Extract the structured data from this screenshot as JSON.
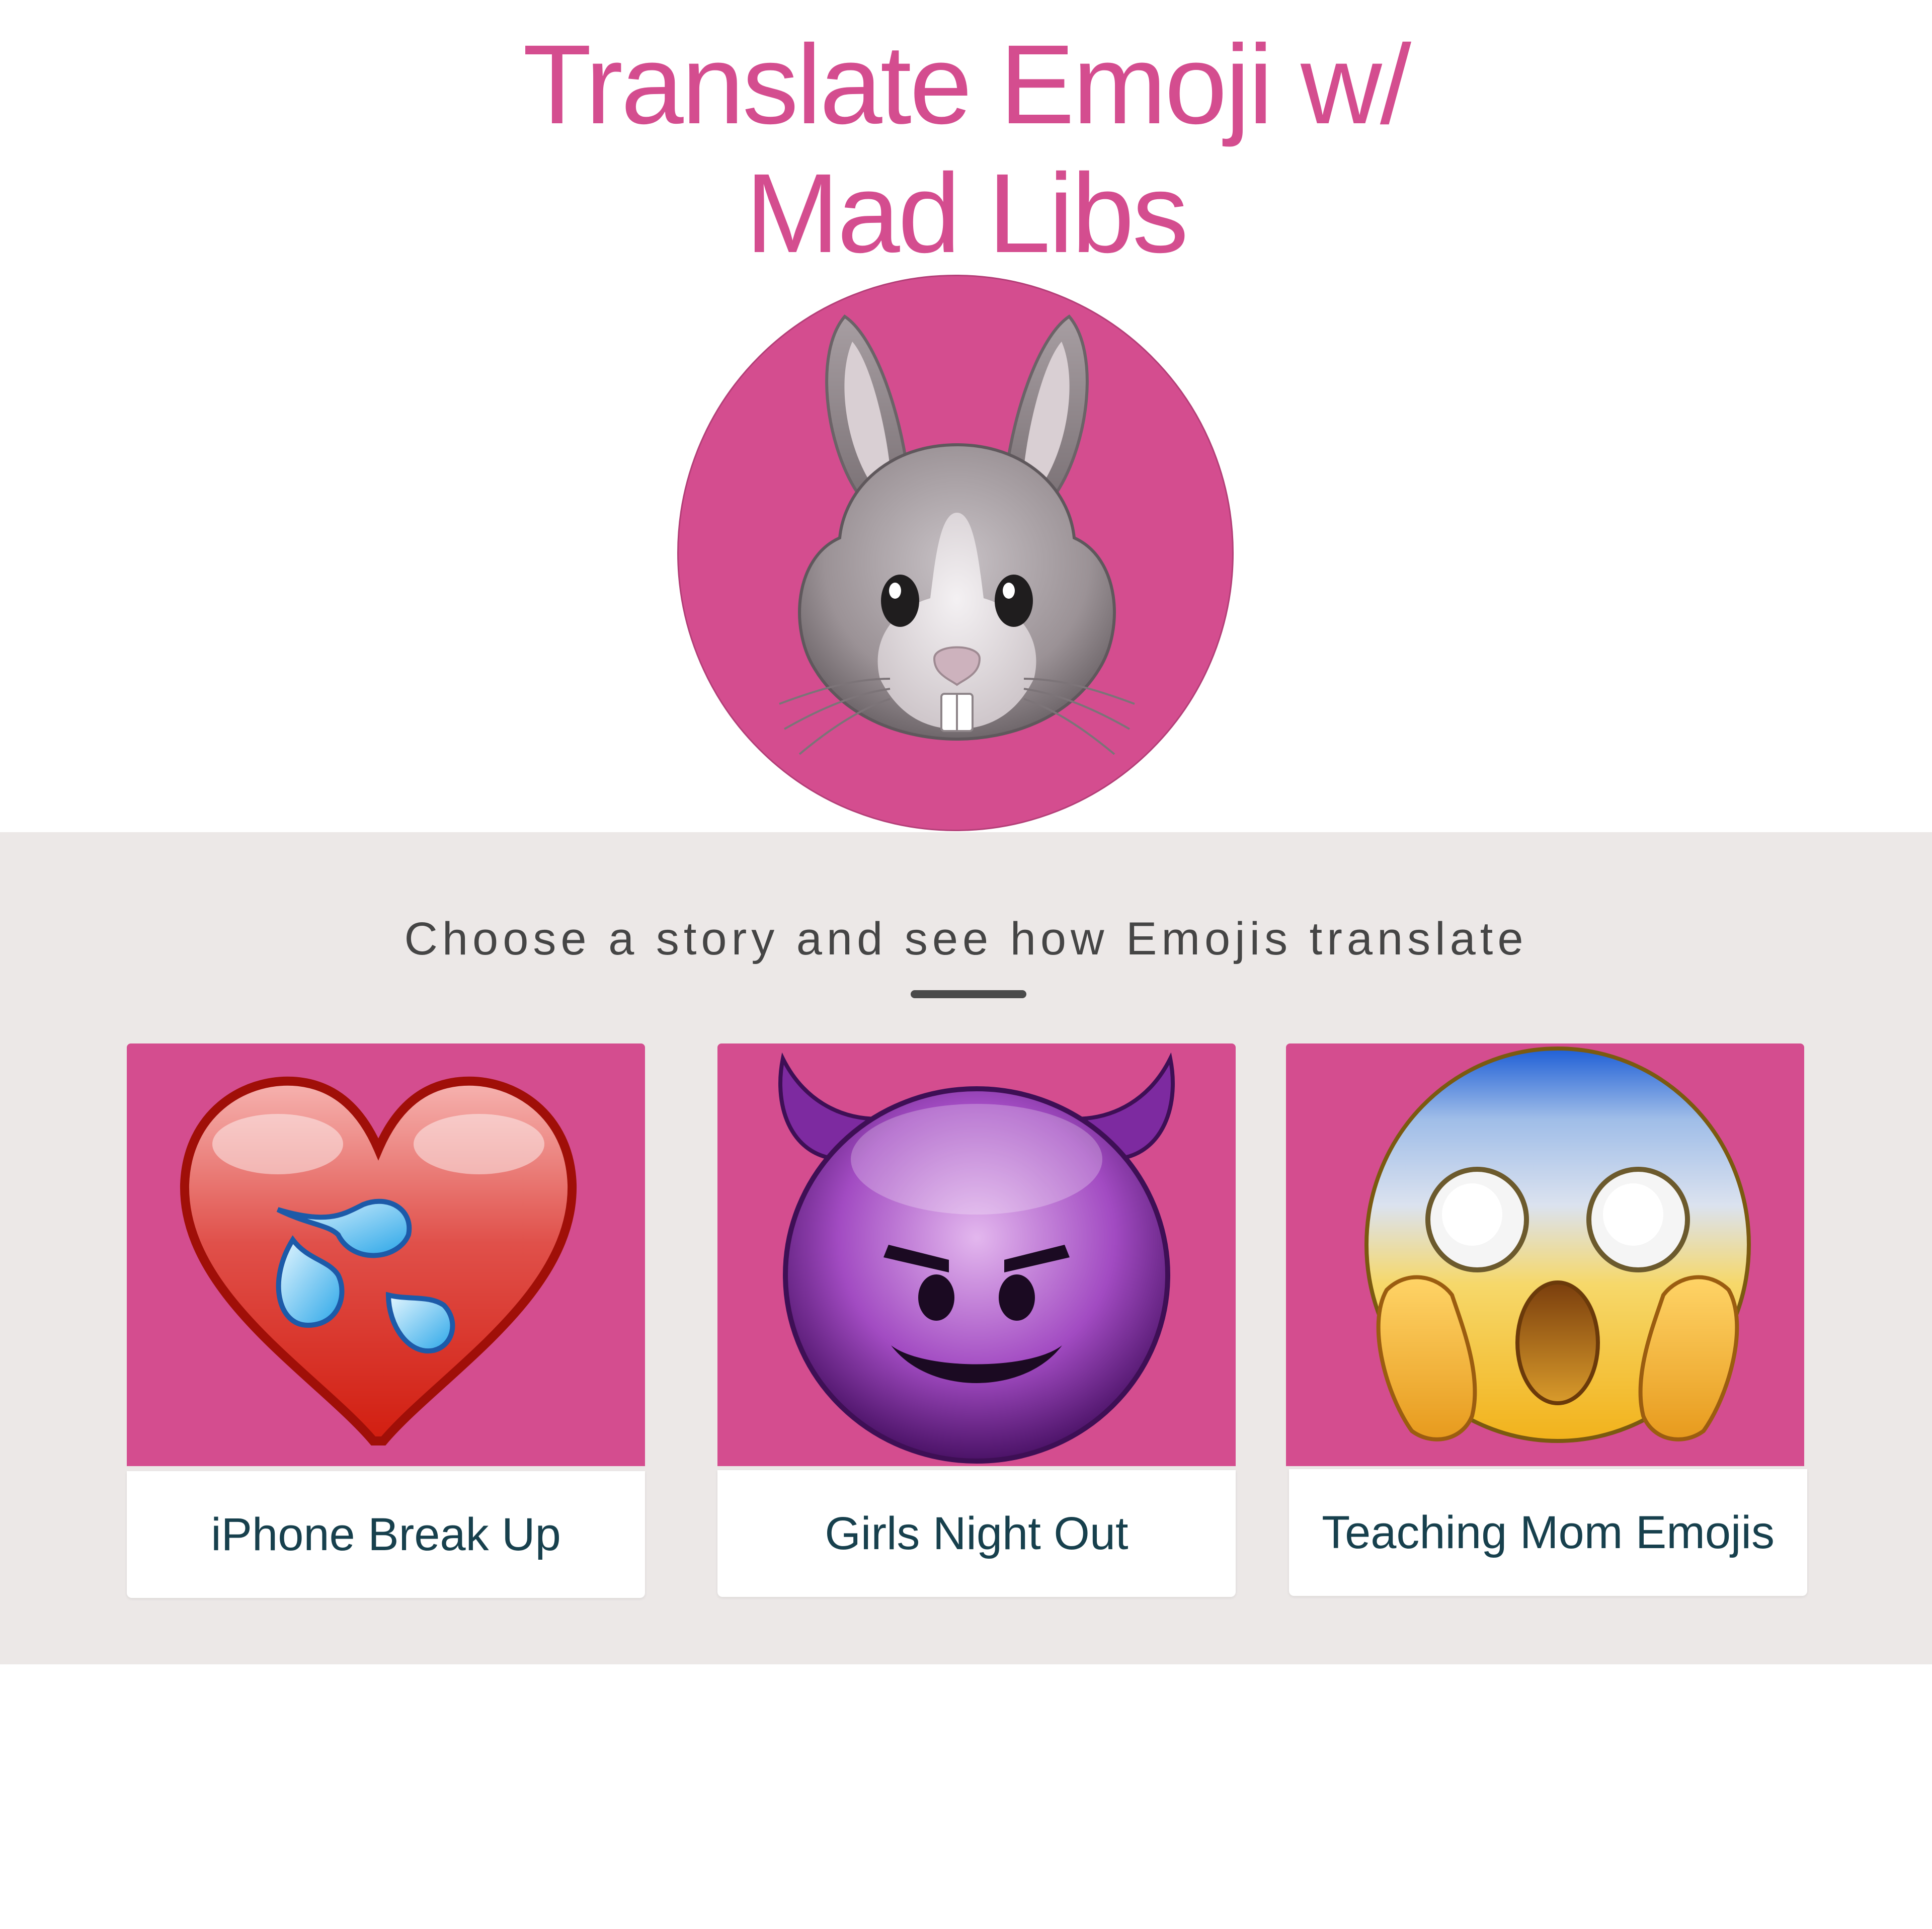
{
  "header": {
    "title_line1": "Translate Emoji w/",
    "title_line2": "Mad Libs",
    "logo_icon": "rabbit-face-icon"
  },
  "stories_section": {
    "prompt": "Choose a story and see how Emojis translate",
    "cards": [
      {
        "label": "iPhone Break Up",
        "icon": "broken-heart-sweat-drops-icon"
      },
      {
        "label": "Girls Night Out",
        "icon": "smiling-devil-icon"
      },
      {
        "label": "Teaching Mom Emojis",
        "icon": "screaming-face-icon"
      }
    ]
  },
  "colors": {
    "brand_pink": "#d44d8f",
    "section_bg": "#ece8e7",
    "label_text": "#17404d",
    "prompt_text": "#454545"
  }
}
